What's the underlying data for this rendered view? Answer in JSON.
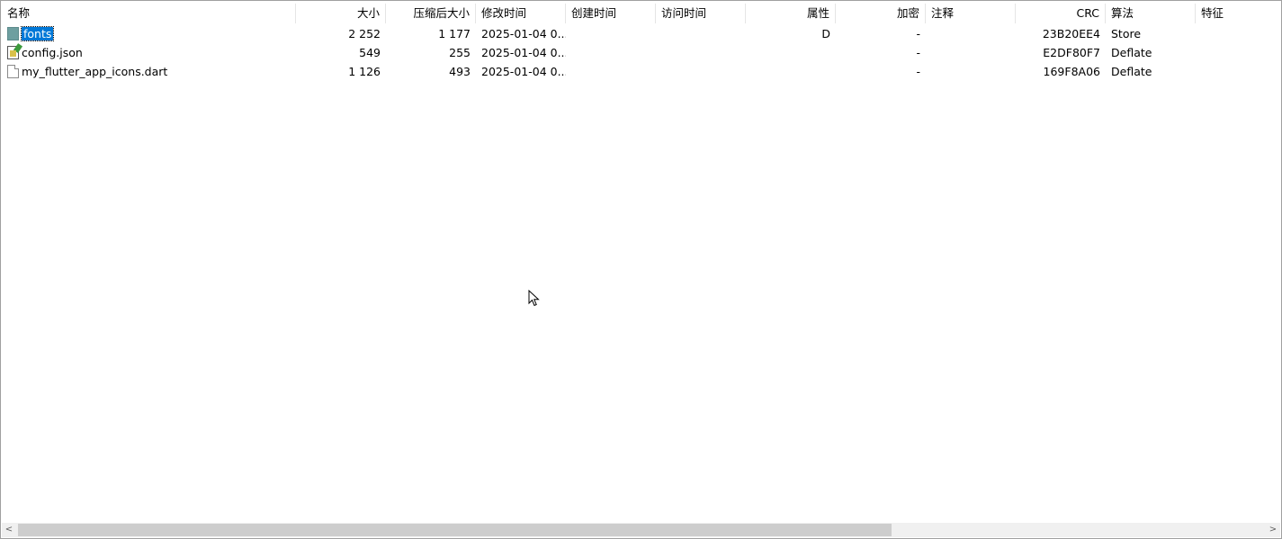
{
  "columns": {
    "name": "名称",
    "size": "大小",
    "packed": "压缩后大小",
    "modified": "修改时间",
    "created": "创建时间",
    "accessed": "访问时间",
    "attributes": "属性",
    "encrypted": "加密",
    "comment": "注释",
    "crc": "CRC",
    "method": "算法",
    "characteristics": "特征"
  },
  "files": [
    {
      "name": "fonts",
      "icon": "folder-icon",
      "size": "2 252",
      "packed": "1 177",
      "modified": "2025-01-04 0...",
      "created": "",
      "accessed": "",
      "attributes": "D",
      "encrypted": "-",
      "comment": "",
      "crc": "23B20EE4",
      "method": "Store",
      "characteristics": "",
      "selected": true
    },
    {
      "name": "config.json",
      "icon": "json-file-icon",
      "size": "549",
      "packed": "255",
      "modified": "2025-01-04 0...",
      "created": "",
      "accessed": "",
      "attributes": "",
      "encrypted": "-",
      "comment": "",
      "crc": "E2DF80F7",
      "method": "Deflate",
      "characteristics": ""
    },
    {
      "name": "my_flutter_app_icons.dart",
      "icon": "document-icon",
      "size": "1 126",
      "packed": "493",
      "modified": "2025-01-04 0...",
      "created": "",
      "accessed": "",
      "attributes": "",
      "encrypted": "-",
      "comment": "",
      "crc": "169F8A06",
      "method": "Deflate",
      "characteristics": ""
    }
  ],
  "scrollbar": {
    "left_arrow": "<",
    "right_arrow": ">"
  }
}
